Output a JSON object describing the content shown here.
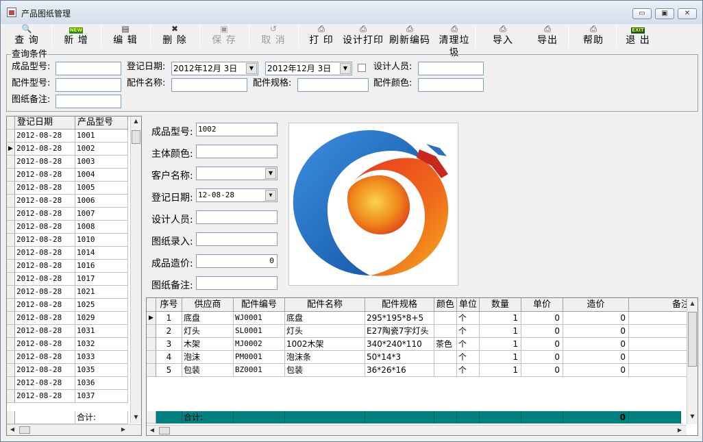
{
  "window": {
    "title": "产品图纸管理",
    "min": "▭",
    "max": "▣",
    "close": "✕"
  },
  "toolbar": [
    {
      "label": "查 询",
      "icon": "search-doc-icon",
      "glyph": "🔍",
      "enabled": true
    },
    {
      "label": "新 增",
      "icon": "new-icon",
      "glyph": "NEW",
      "enabled": true
    },
    {
      "label": "编 辑",
      "icon": "edit-icon",
      "glyph": "▤",
      "enabled": true
    },
    {
      "label": "删 除",
      "icon": "delete-icon",
      "glyph": "✖",
      "enabled": true
    },
    {
      "label": "保 存",
      "icon": "save-icon",
      "glyph": "▣",
      "enabled": false
    },
    {
      "label": "取 消",
      "icon": "undo-icon",
      "glyph": "↺",
      "enabled": false
    },
    {
      "label": "打 印",
      "icon": "printer-icon",
      "glyph": "⎙",
      "enabled": true
    },
    {
      "label": "设计打印",
      "icon": "design-print-icon",
      "glyph": "⎙",
      "enabled": true
    },
    {
      "label": "刷新编码",
      "icon": "refresh-icon",
      "glyph": "⎙",
      "enabled": true
    },
    {
      "label": "清理垃圾",
      "icon": "clean-icon",
      "glyph": "⎙",
      "enabled": true
    },
    {
      "label": "导入",
      "icon": "import-icon",
      "glyph": "⎙",
      "enabled": true
    },
    {
      "label": "导出",
      "icon": "export-icon",
      "glyph": "⎙",
      "enabled": true
    },
    {
      "label": "帮助",
      "icon": "help-icon",
      "glyph": "⎙",
      "enabled": true
    },
    {
      "label": "退 出",
      "icon": "exit-icon",
      "glyph": "EXIT",
      "enabled": true
    }
  ],
  "query": {
    "legend": "查询条件",
    "product_model_label": "成品型号:",
    "product_model_value": "",
    "reg_date_label": "登记日期:",
    "date_from": "2012年12月  3日",
    "date_to": "2012年12月  3日",
    "designer_label": "设计人员:",
    "designer_value": "",
    "part_model_label": "配件型号:",
    "part_name_label": "配件名称:",
    "part_spec_label": "配件规格:",
    "part_color_label": "配件颜色:",
    "drawing_note_label": "图纸备注:"
  },
  "left_grid": {
    "headers": [
      "登记日期",
      "产品型号"
    ],
    "rows": [
      [
        "2012-08-28",
        "1001"
      ],
      [
        "2012-08-28",
        "1002"
      ],
      [
        "2012-08-28",
        "1003"
      ],
      [
        "2012-08-28",
        "1004"
      ],
      [
        "2012-08-28",
        "1005"
      ],
      [
        "2012-08-28",
        "1006"
      ],
      [
        "2012-08-28",
        "1007"
      ],
      [
        "2012-08-28",
        "1008"
      ],
      [
        "2012-08-28",
        "1010"
      ],
      [
        "2012-08-28",
        "1014"
      ],
      [
        "2012-08-28",
        "1016"
      ],
      [
        "2012-08-28",
        "1017"
      ],
      [
        "2012-08-28",
        "1021"
      ],
      [
        "2012-08-28",
        "1025"
      ],
      [
        "2012-08-28",
        "1029"
      ],
      [
        "2012-08-28",
        "1031"
      ],
      [
        "2012-08-28",
        "1032"
      ],
      [
        "2012-08-28",
        "1033"
      ],
      [
        "2012-08-28",
        "1035"
      ],
      [
        "2012-08-28",
        "1036"
      ],
      [
        "2012-08-28",
        "1037"
      ]
    ],
    "selected_index": 1,
    "total_label": "合计:"
  },
  "detail": {
    "product_model_label": "成品型号:",
    "product_model_value": "1002",
    "main_color_label": "主体颜色:",
    "main_color_value": "",
    "customer_label": "客户名称:",
    "customer_value": "",
    "reg_date_label": "登记日期:",
    "reg_date_value": "12-08-28",
    "designer_label": "设计人员:",
    "designer_value": "",
    "drawing_entry_label": "图纸录入:",
    "drawing_entry_value": "",
    "cost_label": "成品造价:",
    "cost_value": "0",
    "note_label": "图纸备注:",
    "note_value": ""
  },
  "parts_grid": {
    "headers": [
      "序号",
      "供应商",
      "配件编号",
      "配件名称",
      "配件规格",
      "颜色",
      "单位",
      "数量",
      "单价",
      "造价",
      "备注"
    ],
    "rows": [
      [
        "1",
        "底盘",
        "WJ0001",
        "底盘",
        "295*195*8+5",
        "",
        "个",
        "1",
        "0",
        "0",
        ""
      ],
      [
        "2",
        "灯头",
        "SL0001",
        "灯头",
        "E27陶瓷7字灯头",
        "",
        "个",
        "1",
        "0",
        "0",
        ""
      ],
      [
        "3",
        "木架",
        "MJ0002",
        "1002木架",
        "340*240*110",
        "茶色",
        "个",
        "1",
        "0",
        "0",
        ""
      ],
      [
        "4",
        "泡沫",
        "PM0001",
        "泡沫条",
        "50*14*3",
        "",
        "个",
        "1",
        "0",
        "0",
        ""
      ],
      [
        "5",
        "包装",
        "BZ0001",
        "包装",
        "36*26*16",
        "",
        "个",
        "1",
        "0",
        "0",
        ""
      ]
    ],
    "total_label": "合计:",
    "total_value": "0"
  },
  "colors": {
    "title_bg": "#dbe3ee",
    "total_row": "#008080",
    "logo_blue": "#1f6fc4",
    "logo_red": "#e03a1c",
    "logo_orange": "#f2a21a"
  }
}
